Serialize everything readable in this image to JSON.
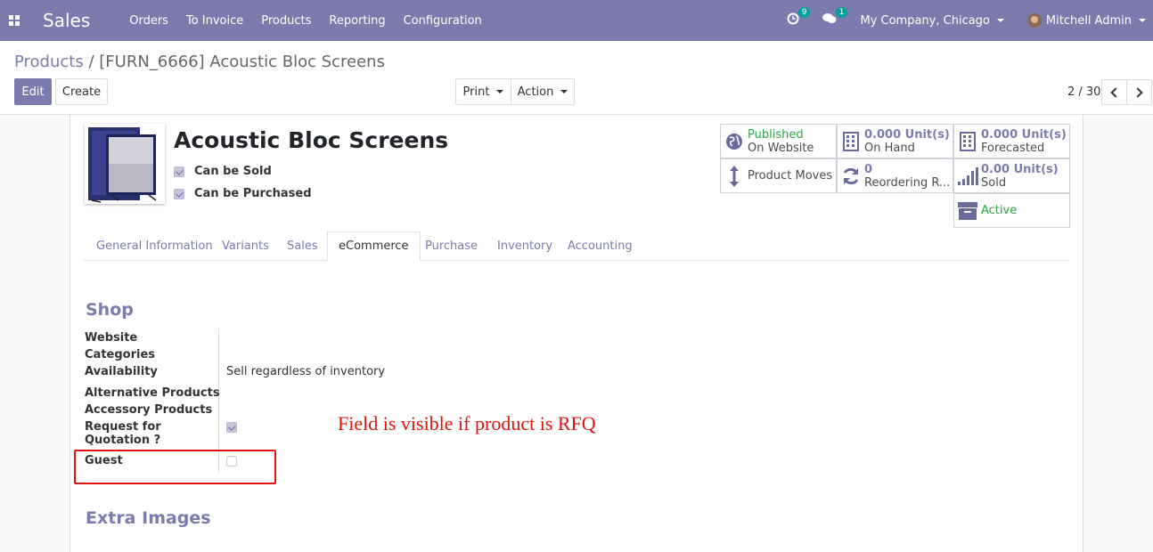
{
  "navbar": {
    "app_name": "Sales",
    "menu": [
      "Orders",
      "To Invoice",
      "Products",
      "Reporting",
      "Configuration"
    ],
    "activity_count": "9",
    "message_count": "1",
    "company": "My Company, Chicago",
    "user": "Mitchell Admin",
    "color": "#7c7bad"
  },
  "breadcrumb": {
    "parent": "Products",
    "separator": "/",
    "current": "[FURN_6666] Acoustic Bloc Screens"
  },
  "buttons": {
    "edit": "Edit",
    "create": "Create",
    "print": "Print",
    "action": "Action"
  },
  "pager": {
    "value": "2 / 30"
  },
  "product": {
    "name": "Acoustic Bloc Screens",
    "can_be_sold_label": "Can be Sold",
    "can_be_sold": true,
    "can_be_purchased_label": "Can be Purchased",
    "can_be_purchased": true
  },
  "smart_buttons": {
    "published": {
      "line1": "Published",
      "line2": "On Website",
      "icon": "globe-icon"
    },
    "on_hand": {
      "value": "0.000",
      "unit": "Unit(s)",
      "label": "On Hand",
      "icon": "building-icon"
    },
    "forecasted": {
      "value": "0.000",
      "unit": "Unit(s)",
      "label": "Forecasted",
      "icon": "building-icon"
    },
    "product_moves": {
      "label": "Product Moves",
      "icon": "arrows-vertical-icon"
    },
    "reordering": {
      "value": "0",
      "label": "Reordering R...",
      "icon": "refresh-icon"
    },
    "sold": {
      "value": "0.00",
      "unit": "Unit(s)",
      "label": "Sold",
      "icon": "bar-chart-icon"
    },
    "active": {
      "label": "Active",
      "icon": "archive-icon"
    }
  },
  "tabs": [
    "General Information",
    "Variants",
    "Sales",
    "eCommerce",
    "Purchase",
    "Inventory",
    "Accounting"
  ],
  "active_tab": "eCommerce",
  "shop": {
    "title": "Shop",
    "website_label": "Website",
    "categories_label": "Categories",
    "availability_label": "Availability",
    "availability_value": "Sell regardless of inventory",
    "alternative_label": "Alternative Products",
    "accessory_label": "Accessory Products",
    "rfq_label_line1": "Request for",
    "rfq_label_line2": "Quotation ?",
    "rfq_checked": true,
    "guest_label": "Guest",
    "guest_checked": false
  },
  "extra_images_title": "Extra Images",
  "annotation": {
    "text": "Field is visible if product is RFQ",
    "color": "#e0140f"
  }
}
